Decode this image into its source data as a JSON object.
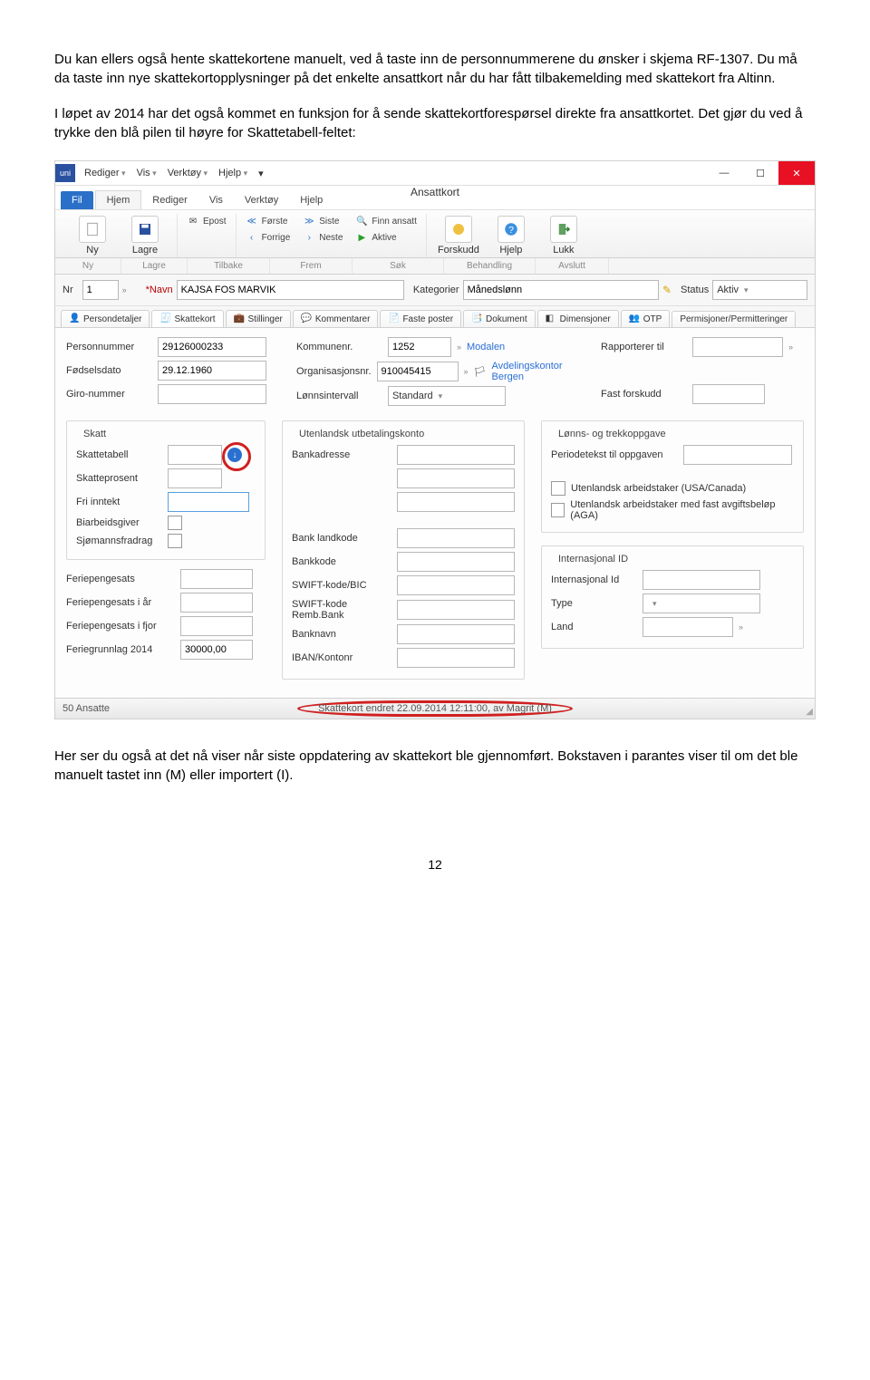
{
  "para1": "Du kan ellers også hente skattekortene manuelt, ved å taste inn de personnummerene du ønsker i skjema RF-1307. Du må da taste inn nye skattekortopplysninger på det enkelte ansattkort når du har fått tilbakemelding med skattekort fra Altinn.",
  "para2": "I løpet av 2014 har det også kommet en funksjon for å sende skattekortforespørsel direkte fra ansattkortet. Det gjør du ved å trykke den blå pilen til høyre for Skattetabell-feltet:",
  "para3": "Her ser du også at det nå viser når siste oppdatering av skattekort ble gjennomført. Bokstaven i parantes viser til om det ble manuelt tastet inn (M) eller importert (I).",
  "pagenum": "12",
  "win": {
    "title": "Ansattkort",
    "menus": [
      "Rediger",
      "Vis",
      "Verktøy",
      "Hjelp"
    ]
  },
  "ribbon": {
    "file": "Fil",
    "tabs": [
      "Hjem",
      "Rediger",
      "Vis",
      "Verktøy",
      "Hjelp"
    ],
    "ny": "Ny",
    "lagre": "Lagre",
    "epost": "Epost",
    "forste": "Første",
    "siste": "Siste",
    "finn": "Finn ansatt",
    "forrige": "Forrige",
    "neste": "Neste",
    "aktive": "Aktive",
    "forskudd": "Forskudd",
    "hjelp": "Hjelp",
    "lukk": "Lukk",
    "groups": [
      "Ny",
      "Lagre",
      "Tilbake",
      "Frem",
      "Søk",
      "Behandling",
      "Avslutt"
    ]
  },
  "header": {
    "nr_lbl": "Nr",
    "nr_val": "1",
    "navn_lbl": "Navn",
    "navn_val": "KAJSA FOS MARVIK",
    "kat_lbl": "Kategorier",
    "kat_val": "Månedslønn",
    "status_lbl": "Status",
    "status_val": "Aktiv"
  },
  "tabs": {
    "t1": "Persondetaljer",
    "t2": "Skattekort",
    "t3": "Stillinger",
    "t4": "Kommentarer",
    "t5": "Faste poster",
    "t6": "Dokument",
    "t7": "Dimensjoner",
    "t8": "OTP",
    "t9": "Permisjoner/Permitteringer"
  },
  "form": {
    "personnr_lbl": "Personnummer",
    "personnr_val": "29126000233",
    "fdato_lbl": "Fødselsdato",
    "fdato_val": "29.12.1960",
    "giro_lbl": "Giro-nummer",
    "kommune_lbl": "Kommunenr.",
    "kommune_val": "1252",
    "kommune_name": "Modalen",
    "org_lbl": "Organisasjonsnr.",
    "org_val": "910045415",
    "org_name": "Avdelingskontor Bergen",
    "lonnint_lbl": "Lønnsintervall",
    "lonnint_val": "Standard",
    "rapp_lbl": "Rapporterer til",
    "fast_lbl": "Fast forskudd",
    "skatt_legend": "Skatt",
    "tabell_lbl": "Skattetabell",
    "prosent_lbl": "Skatteprosent",
    "fri_lbl": "Fri inntekt",
    "biarb_lbl": "Biarbeidsgiver",
    "sjomann_lbl": "Sjømannsfradrag",
    "fpsats_lbl": "Feriepengesats",
    "fpiaar_lbl": "Feriepengesats i år",
    "fpifjor_lbl": "Feriepengesats i fjor",
    "fg2014_lbl": "Feriegrunnlag 2014",
    "fg2014_val": "30000,00",
    "utb_legend": "Utenlandsk utbetalingskonto",
    "bankadr_lbl": "Bankadresse",
    "blandkode_lbl": "Bank landkode",
    "bankkode_lbl": "Bankkode",
    "swift_lbl": "SWIFT-kode/BIC",
    "swiftremb_lbl": "SWIFT-kode Remb.Bank",
    "banknavn_lbl": "Banknavn",
    "iban_lbl": "IBAN/Kontonr",
    "lto_legend": "Lønns- og trekkoppgave",
    "periodetekst_lbl": "Periodetekst til oppgaven",
    "utl1": "Utenlandsk arbeidstaker (USA/Canada)",
    "utl2": "Utenlandsk arbeidstaker med fast avgiftsbeløp (AGA)",
    "intid_legend": "Internasjonal ID",
    "intid_lbl": "Internasjonal Id",
    "type_lbl": "Type",
    "land_lbl": "Land"
  },
  "status": {
    "left": "50 Ansatte",
    "center": "Skattekort endret 22.09.2014 12:11:00, av Magrit (M)"
  }
}
